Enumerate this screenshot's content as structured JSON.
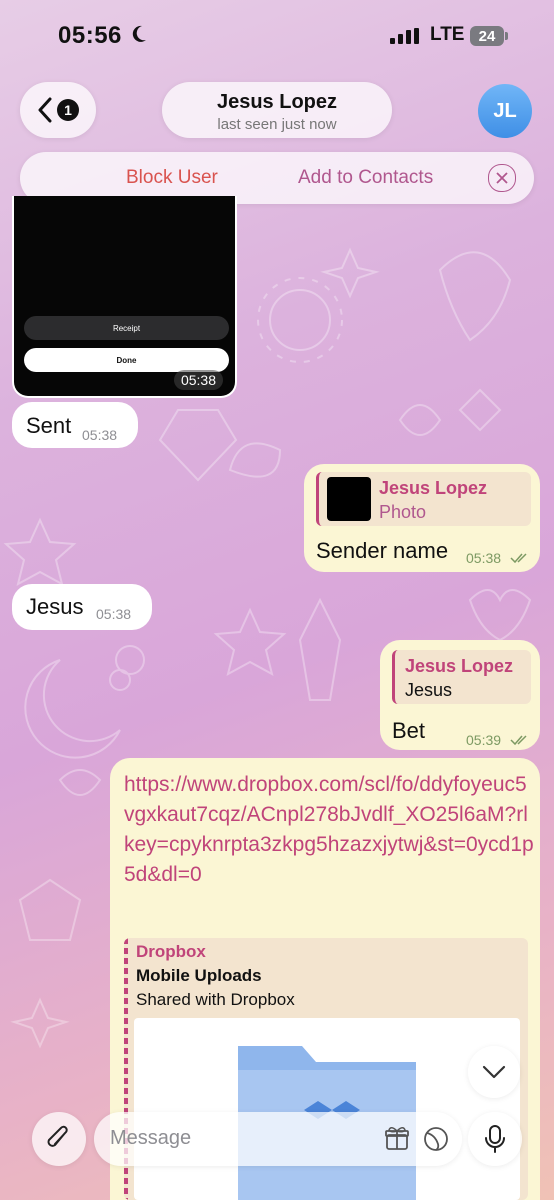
{
  "status_bar": {
    "time": "05:56",
    "network": "LTE",
    "battery": "24"
  },
  "header": {
    "back_badge": "1",
    "contact_name": "Jesus Lopez",
    "last_seen": "last seen just now",
    "avatar_initials": "JL",
    "avatar_color": "#4a9cef"
  },
  "action_bar": {
    "block_label": "Block User",
    "add_contact_label": "Add to Contacts"
  },
  "messages": {
    "image_msg": {
      "receipt_label": "Receipt",
      "done_label": "Done",
      "time": "05:38"
    },
    "sent_in": {
      "text": "Sent",
      "time": "05:38"
    },
    "reply_out_1": {
      "reply_name": "Jesus Lopez",
      "reply_sub": "Photo",
      "text": "Sender name",
      "time": "05:38"
    },
    "jesus_in": {
      "text": "Jesus",
      "time": "05:38"
    },
    "reply_out_2": {
      "reply_name": "Jesus Lopez",
      "reply_sub": "Jesus",
      "text": "Bet",
      "time": "05:39"
    },
    "link_out": {
      "url": "https://www.dropbox.com/scl/fo/ddyfoyeuc5vgxkaut7cqz/ACnpl278bJvdlf_XO25l6aM?rlkey=cpyknrpta3zkpg5hzazxjytwj&st=0ycd1p5d&dl=0",
      "preview_site": "Dropbox",
      "preview_title": "Mobile Uploads",
      "preview_desc": "Shared with Dropbox"
    }
  },
  "input": {
    "placeholder": "Message"
  },
  "colors": {
    "accent": "#c0447a",
    "outgoing_bubble": "#fbf6d4",
    "destructive": "#d9534f"
  }
}
